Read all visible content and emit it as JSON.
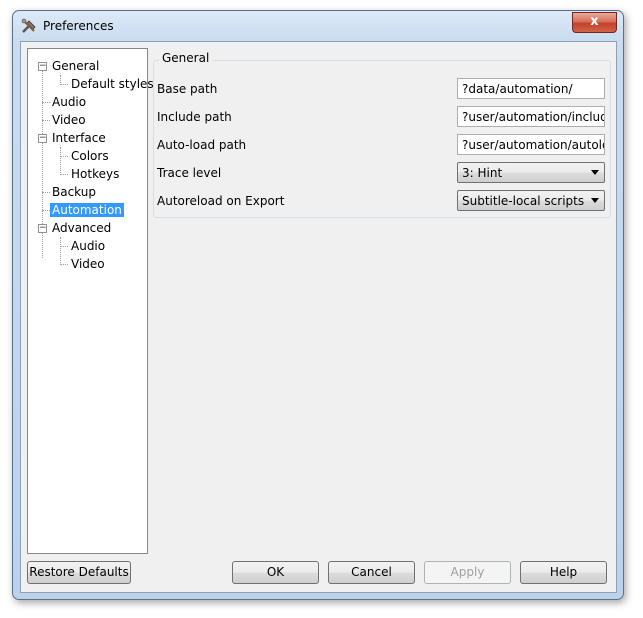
{
  "window": {
    "title": "Preferences",
    "close_glyph": "x"
  },
  "tree": {
    "items": [
      {
        "label": "General"
      },
      {
        "label": "Default styles"
      },
      {
        "label": "Audio"
      },
      {
        "label": "Video"
      },
      {
        "label": "Interface"
      },
      {
        "label": "Colors"
      },
      {
        "label": "Hotkeys"
      },
      {
        "label": "Backup"
      },
      {
        "label": "Automation",
        "selected": true
      },
      {
        "label": "Advanced"
      },
      {
        "label": "Audio"
      },
      {
        "label": "Video"
      }
    ],
    "expander_glyph": "−"
  },
  "group": {
    "title": "General",
    "base_path": {
      "label": "Base path",
      "value": "?data/automation/"
    },
    "include_path": {
      "label": "Include path",
      "value": "?user/automation/include/"
    },
    "autoload_path": {
      "label": "Auto-load path",
      "value": "?user/automation/autoload/"
    },
    "trace_level": {
      "label": "Trace level",
      "value": "3: Hint"
    },
    "autoreload": {
      "label": "Autoreload on Export",
      "value": "Subtitle-local scripts"
    }
  },
  "buttons": {
    "restore_defaults": "Restore Defaults",
    "ok": "OK",
    "cancel": "Cancel",
    "apply": "Apply",
    "help": "Help"
  },
  "colors": {
    "selection": "#3399ff",
    "close_button": "#c4412a"
  }
}
